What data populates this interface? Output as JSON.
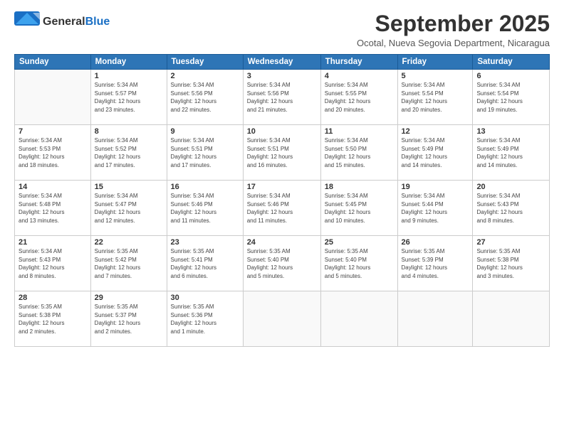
{
  "logo": {
    "general": "General",
    "blue": "Blue"
  },
  "title": "September 2025",
  "subtitle": "Ocotal, Nueva Segovia Department, Nicaragua",
  "days": [
    "Sunday",
    "Monday",
    "Tuesday",
    "Wednesday",
    "Thursday",
    "Friday",
    "Saturday"
  ],
  "weeks": [
    [
      {
        "num": "",
        "info": ""
      },
      {
        "num": "1",
        "info": "Sunrise: 5:34 AM\nSunset: 5:57 PM\nDaylight: 12 hours\nand 23 minutes."
      },
      {
        "num": "2",
        "info": "Sunrise: 5:34 AM\nSunset: 5:56 PM\nDaylight: 12 hours\nand 22 minutes."
      },
      {
        "num": "3",
        "info": "Sunrise: 5:34 AM\nSunset: 5:56 PM\nDaylight: 12 hours\nand 21 minutes."
      },
      {
        "num": "4",
        "info": "Sunrise: 5:34 AM\nSunset: 5:55 PM\nDaylight: 12 hours\nand 20 minutes."
      },
      {
        "num": "5",
        "info": "Sunrise: 5:34 AM\nSunset: 5:54 PM\nDaylight: 12 hours\nand 20 minutes."
      },
      {
        "num": "6",
        "info": "Sunrise: 5:34 AM\nSunset: 5:54 PM\nDaylight: 12 hours\nand 19 minutes."
      }
    ],
    [
      {
        "num": "7",
        "info": "Sunrise: 5:34 AM\nSunset: 5:53 PM\nDaylight: 12 hours\nand 18 minutes."
      },
      {
        "num": "8",
        "info": "Sunrise: 5:34 AM\nSunset: 5:52 PM\nDaylight: 12 hours\nand 17 minutes."
      },
      {
        "num": "9",
        "info": "Sunrise: 5:34 AM\nSunset: 5:51 PM\nDaylight: 12 hours\nand 17 minutes."
      },
      {
        "num": "10",
        "info": "Sunrise: 5:34 AM\nSunset: 5:51 PM\nDaylight: 12 hours\nand 16 minutes."
      },
      {
        "num": "11",
        "info": "Sunrise: 5:34 AM\nSunset: 5:50 PM\nDaylight: 12 hours\nand 15 minutes."
      },
      {
        "num": "12",
        "info": "Sunrise: 5:34 AM\nSunset: 5:49 PM\nDaylight: 12 hours\nand 14 minutes."
      },
      {
        "num": "13",
        "info": "Sunrise: 5:34 AM\nSunset: 5:49 PM\nDaylight: 12 hours\nand 14 minutes."
      }
    ],
    [
      {
        "num": "14",
        "info": "Sunrise: 5:34 AM\nSunset: 5:48 PM\nDaylight: 12 hours\nand 13 minutes."
      },
      {
        "num": "15",
        "info": "Sunrise: 5:34 AM\nSunset: 5:47 PM\nDaylight: 12 hours\nand 12 minutes."
      },
      {
        "num": "16",
        "info": "Sunrise: 5:34 AM\nSunset: 5:46 PM\nDaylight: 12 hours\nand 11 minutes."
      },
      {
        "num": "17",
        "info": "Sunrise: 5:34 AM\nSunset: 5:46 PM\nDaylight: 12 hours\nand 11 minutes."
      },
      {
        "num": "18",
        "info": "Sunrise: 5:34 AM\nSunset: 5:45 PM\nDaylight: 12 hours\nand 10 minutes."
      },
      {
        "num": "19",
        "info": "Sunrise: 5:34 AM\nSunset: 5:44 PM\nDaylight: 12 hours\nand 9 minutes."
      },
      {
        "num": "20",
        "info": "Sunrise: 5:34 AM\nSunset: 5:43 PM\nDaylight: 12 hours\nand 8 minutes."
      }
    ],
    [
      {
        "num": "21",
        "info": "Sunrise: 5:34 AM\nSunset: 5:43 PM\nDaylight: 12 hours\nand 8 minutes."
      },
      {
        "num": "22",
        "info": "Sunrise: 5:35 AM\nSunset: 5:42 PM\nDaylight: 12 hours\nand 7 minutes."
      },
      {
        "num": "23",
        "info": "Sunrise: 5:35 AM\nSunset: 5:41 PM\nDaylight: 12 hours\nand 6 minutes."
      },
      {
        "num": "24",
        "info": "Sunrise: 5:35 AM\nSunset: 5:40 PM\nDaylight: 12 hours\nand 5 minutes."
      },
      {
        "num": "25",
        "info": "Sunrise: 5:35 AM\nSunset: 5:40 PM\nDaylight: 12 hours\nand 5 minutes."
      },
      {
        "num": "26",
        "info": "Sunrise: 5:35 AM\nSunset: 5:39 PM\nDaylight: 12 hours\nand 4 minutes."
      },
      {
        "num": "27",
        "info": "Sunrise: 5:35 AM\nSunset: 5:38 PM\nDaylight: 12 hours\nand 3 minutes."
      }
    ],
    [
      {
        "num": "28",
        "info": "Sunrise: 5:35 AM\nSunset: 5:38 PM\nDaylight: 12 hours\nand 2 minutes."
      },
      {
        "num": "29",
        "info": "Sunrise: 5:35 AM\nSunset: 5:37 PM\nDaylight: 12 hours\nand 2 minutes."
      },
      {
        "num": "30",
        "info": "Sunrise: 5:35 AM\nSunset: 5:36 PM\nDaylight: 12 hours\nand 1 minute."
      },
      {
        "num": "",
        "info": ""
      },
      {
        "num": "",
        "info": ""
      },
      {
        "num": "",
        "info": ""
      },
      {
        "num": "",
        "info": ""
      }
    ]
  ]
}
